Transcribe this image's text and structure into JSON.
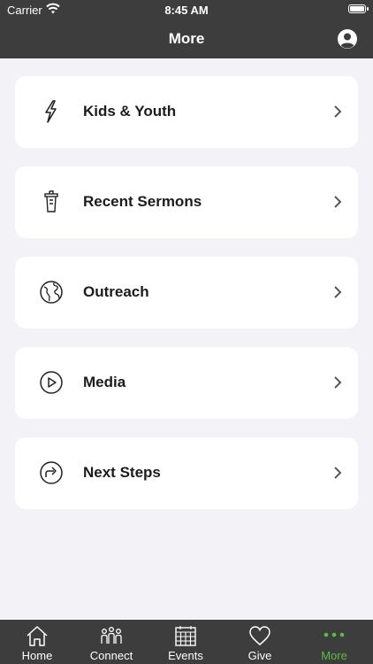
{
  "status": {
    "carrier": "Carrier",
    "time": "8:45 AM"
  },
  "header": {
    "title": "More"
  },
  "items": [
    {
      "label": "Kids & Youth",
      "icon": "lightning-icon"
    },
    {
      "label": "Recent Sermons",
      "icon": "podium-icon"
    },
    {
      "label": "Outreach",
      "icon": "globe-icon"
    },
    {
      "label": "Media",
      "icon": "play-circle-icon"
    },
    {
      "label": "Next Steps",
      "icon": "forward-arrow-circle-icon"
    }
  ],
  "tabs": [
    {
      "label": "Home",
      "icon": "home-icon"
    },
    {
      "label": "Connect",
      "icon": "people-icon"
    },
    {
      "label": "Events",
      "icon": "calendar-icon"
    },
    {
      "label": "Give",
      "icon": "heart-icon"
    },
    {
      "label": "More",
      "icon": "more-dots-icon",
      "active": true
    }
  ],
  "colors": {
    "bar": "#3d3d3d",
    "accent": "#5dbb46",
    "background": "#f2f2f7"
  }
}
